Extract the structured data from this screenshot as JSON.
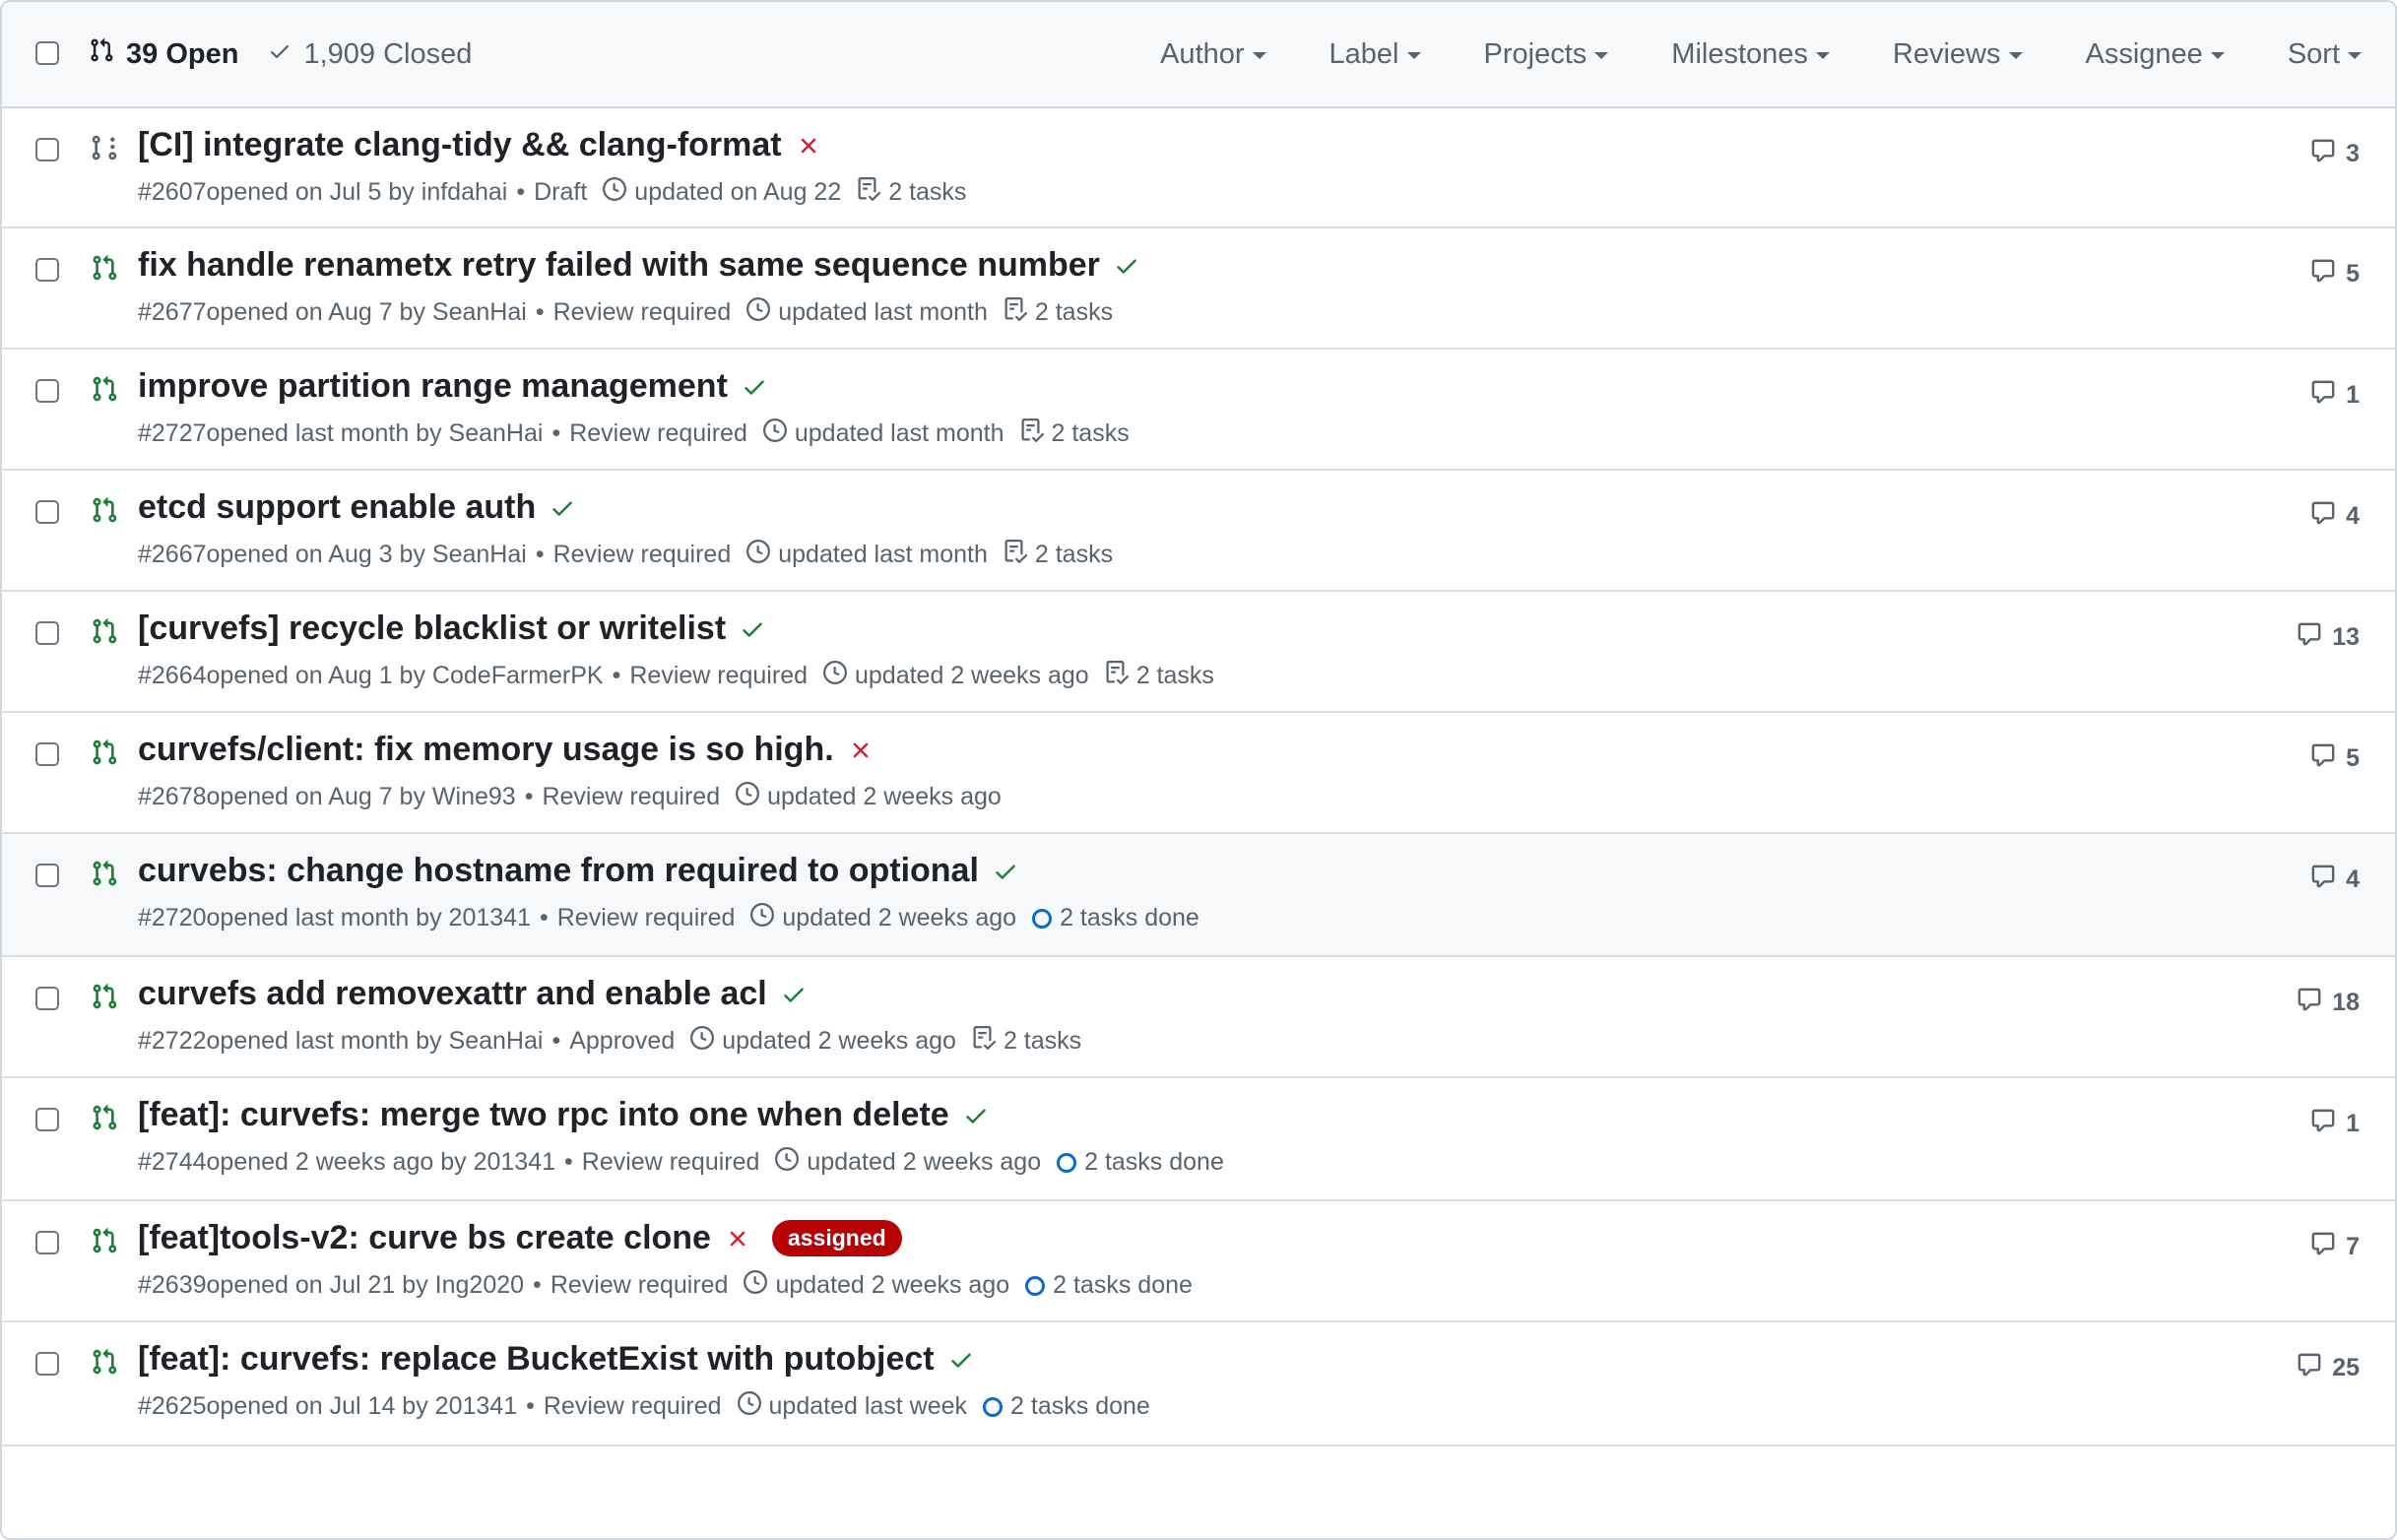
{
  "header": {
    "open_label": "39 Open",
    "closed_label": "1,909 Closed",
    "filters": [
      "Author",
      "Label",
      "Projects",
      "Milestones",
      "Reviews",
      "Assignee",
      "Sort"
    ]
  },
  "colors": {
    "open_green": "#1a7f37",
    "draft_gray": "#59636e",
    "fail_red": "#cf222e",
    "label_red": "#b60205",
    "progress_blue": "#0969da"
  },
  "pull_requests": [
    {
      "title": "[CI] integrate clang-tidy && clang-format",
      "status": "fail",
      "draft": true,
      "number": "#2607",
      "opened": "opened on Jul 5 by",
      "author": "infdahai",
      "review": "Draft",
      "updated": "updated on Aug 22",
      "tasks": "2 tasks",
      "tasks_icon": "checklist-icon",
      "comments": "3",
      "label": ""
    },
    {
      "title": "fix handle renametx retry failed with same sequence number",
      "status": "success",
      "draft": false,
      "number": "#2677",
      "opened": "opened on Aug 7 by",
      "author": "SeanHai",
      "review": "Review required",
      "updated": "updated last month",
      "tasks": "2 tasks",
      "tasks_icon": "checklist-icon",
      "comments": "5",
      "label": ""
    },
    {
      "title": "improve partition range management",
      "status": "success",
      "draft": false,
      "number": "#2727",
      "opened": "opened last month by",
      "author": "SeanHai",
      "review": "Review required",
      "updated": "updated last month",
      "tasks": "2 tasks",
      "tasks_icon": "checklist-icon",
      "comments": "1",
      "label": ""
    },
    {
      "title": "etcd support enable auth",
      "status": "success",
      "draft": false,
      "number": "#2667",
      "opened": "opened on Aug 3 by",
      "author": "SeanHai",
      "review": "Review required",
      "updated": "updated last month",
      "tasks": "2 tasks",
      "tasks_icon": "checklist-icon",
      "comments": "4",
      "label": ""
    },
    {
      "title": "[curvefs] recycle blacklist or writelist",
      "status": "success",
      "draft": false,
      "number": "#2664",
      "opened": "opened on Aug 1 by",
      "author": "CodeFarmerPK",
      "review": "Review required",
      "updated": "updated 2 weeks ago",
      "tasks": "2 tasks",
      "tasks_icon": "checklist-icon",
      "comments": "13",
      "label": ""
    },
    {
      "title": "curvefs/client: fix memory usage is so high.",
      "status": "fail",
      "draft": false,
      "number": "#2678",
      "opened": "opened on Aug 7 by",
      "author": "Wine93",
      "review": "Review required",
      "updated": "updated 2 weeks ago",
      "tasks": "",
      "tasks_icon": "",
      "comments": "5",
      "label": ""
    },
    {
      "title": "curvebs: change hostname from required to optional",
      "status": "success",
      "draft": false,
      "number": "#2720",
      "opened": "opened last month by",
      "author": "201341",
      "review": "Review required",
      "updated": "updated 2 weeks ago",
      "tasks": "2 tasks done",
      "tasks_icon": "progress-ring-icon",
      "comments": "4",
      "label": "",
      "highlighted": true
    },
    {
      "title": "curvefs add removexattr and enable acl",
      "status": "success",
      "draft": false,
      "number": "#2722",
      "opened": "opened last month by",
      "author": "SeanHai",
      "review": "Approved",
      "updated": "updated 2 weeks ago",
      "tasks": "2 tasks",
      "tasks_icon": "checklist-icon",
      "comments": "18",
      "label": ""
    },
    {
      "title": "[feat]: curvefs: merge two rpc into one when delete",
      "status": "success",
      "draft": false,
      "number": "#2744",
      "opened": "opened 2 weeks ago by",
      "author": "201341",
      "review": "Review required",
      "updated": "updated 2 weeks ago",
      "tasks": "2 tasks done",
      "tasks_icon": "progress-ring-icon",
      "comments": "1",
      "label": ""
    },
    {
      "title": "[feat]tools-v2: curve bs create clone",
      "status": "fail",
      "draft": false,
      "number": "#2639",
      "opened": "opened on Jul 21 by",
      "author": "Ing2020",
      "review": "Review required",
      "updated": "updated 2 weeks ago",
      "tasks": "2 tasks done",
      "tasks_icon": "progress-ring-icon",
      "comments": "7",
      "label": "assigned"
    },
    {
      "title": "[feat]: curvefs: replace BucketExist with putobject",
      "status": "success",
      "draft": false,
      "number": "#2625",
      "opened": "opened on Jul 14 by",
      "author": "201341",
      "review": "Review required",
      "updated": "updated last week",
      "tasks": "2 tasks done",
      "tasks_icon": "progress-ring-icon",
      "comments": "25",
      "label": ""
    }
  ]
}
